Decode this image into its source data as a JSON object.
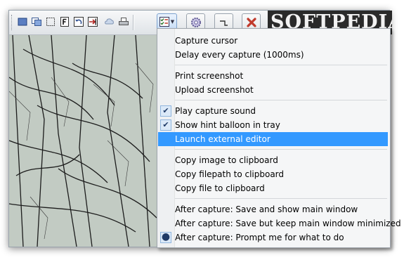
{
  "brand": {
    "logo_text": "SOFTPEDIA"
  },
  "menu": {
    "items": [
      {
        "id": "capture-cursor",
        "label": "Capture cursor",
        "checked": false
      },
      {
        "id": "delay-capture",
        "label": "Delay every capture (1000ms)",
        "checked": false
      },
      {
        "id": "print-screenshot",
        "label": "Print screenshot",
        "checked": false
      },
      {
        "id": "upload-screenshot",
        "label": "Upload screenshot",
        "checked": false
      },
      {
        "id": "play-capture-sound",
        "label": "Play capture sound",
        "checked": true
      },
      {
        "id": "show-hint-balloon",
        "label": "Show hint balloon in tray",
        "checked": true
      },
      {
        "id": "launch-external-editor",
        "label": "Launch external editor",
        "checked": false,
        "highlighted": true
      },
      {
        "id": "copy-image",
        "label": "Copy image to clipboard",
        "checked": false
      },
      {
        "id": "copy-filepath",
        "label": "Copy filepath to clipboard",
        "checked": false
      },
      {
        "id": "copy-file",
        "label": "Copy file to clipboard",
        "checked": false
      },
      {
        "id": "after-save-show",
        "label": "After capture: Save and show main window",
        "checked": false
      },
      {
        "id": "after-save-minimized",
        "label": "After capture: Save but keep main window minimized",
        "checked": false
      },
      {
        "id": "after-prompt",
        "label": "After capture: Prompt me for what to do",
        "radio": true
      }
    ]
  },
  "colors": {
    "highlight": "#3399ff",
    "toolbar_active_border": "#7da2ce"
  }
}
